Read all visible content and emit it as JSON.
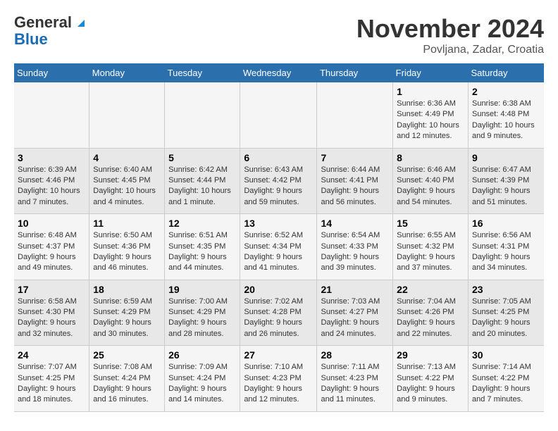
{
  "logo": {
    "line1": "General",
    "line2": "Blue"
  },
  "title": "November 2024",
  "subtitle": "Povljana, Zadar, Croatia",
  "header_color": "#2c6fad",
  "days_of_week": [
    "Sunday",
    "Monday",
    "Tuesday",
    "Wednesday",
    "Thursday",
    "Friday",
    "Saturday"
  ],
  "weeks": [
    [
      {
        "day": "",
        "info": ""
      },
      {
        "day": "",
        "info": ""
      },
      {
        "day": "",
        "info": ""
      },
      {
        "day": "",
        "info": ""
      },
      {
        "day": "",
        "info": ""
      },
      {
        "day": "1",
        "info": "Sunrise: 6:36 AM\nSunset: 4:49 PM\nDaylight: 10 hours and 12 minutes."
      },
      {
        "day": "2",
        "info": "Sunrise: 6:38 AM\nSunset: 4:48 PM\nDaylight: 10 hours and 9 minutes."
      }
    ],
    [
      {
        "day": "3",
        "info": "Sunrise: 6:39 AM\nSunset: 4:46 PM\nDaylight: 10 hours and 7 minutes."
      },
      {
        "day": "4",
        "info": "Sunrise: 6:40 AM\nSunset: 4:45 PM\nDaylight: 10 hours and 4 minutes."
      },
      {
        "day": "5",
        "info": "Sunrise: 6:42 AM\nSunset: 4:44 PM\nDaylight: 10 hours and 1 minute."
      },
      {
        "day": "6",
        "info": "Sunrise: 6:43 AM\nSunset: 4:42 PM\nDaylight: 9 hours and 59 minutes."
      },
      {
        "day": "7",
        "info": "Sunrise: 6:44 AM\nSunset: 4:41 PM\nDaylight: 9 hours and 56 minutes."
      },
      {
        "day": "8",
        "info": "Sunrise: 6:46 AM\nSunset: 4:40 PM\nDaylight: 9 hours and 54 minutes."
      },
      {
        "day": "9",
        "info": "Sunrise: 6:47 AM\nSunset: 4:39 PM\nDaylight: 9 hours and 51 minutes."
      }
    ],
    [
      {
        "day": "10",
        "info": "Sunrise: 6:48 AM\nSunset: 4:37 PM\nDaylight: 9 hours and 49 minutes."
      },
      {
        "day": "11",
        "info": "Sunrise: 6:50 AM\nSunset: 4:36 PM\nDaylight: 9 hours and 46 minutes."
      },
      {
        "day": "12",
        "info": "Sunrise: 6:51 AM\nSunset: 4:35 PM\nDaylight: 9 hours and 44 minutes."
      },
      {
        "day": "13",
        "info": "Sunrise: 6:52 AM\nSunset: 4:34 PM\nDaylight: 9 hours and 41 minutes."
      },
      {
        "day": "14",
        "info": "Sunrise: 6:54 AM\nSunset: 4:33 PM\nDaylight: 9 hours and 39 minutes."
      },
      {
        "day": "15",
        "info": "Sunrise: 6:55 AM\nSunset: 4:32 PM\nDaylight: 9 hours and 37 minutes."
      },
      {
        "day": "16",
        "info": "Sunrise: 6:56 AM\nSunset: 4:31 PM\nDaylight: 9 hours and 34 minutes."
      }
    ],
    [
      {
        "day": "17",
        "info": "Sunrise: 6:58 AM\nSunset: 4:30 PM\nDaylight: 9 hours and 32 minutes."
      },
      {
        "day": "18",
        "info": "Sunrise: 6:59 AM\nSunset: 4:29 PM\nDaylight: 9 hours and 30 minutes."
      },
      {
        "day": "19",
        "info": "Sunrise: 7:00 AM\nSunset: 4:29 PM\nDaylight: 9 hours and 28 minutes."
      },
      {
        "day": "20",
        "info": "Sunrise: 7:02 AM\nSunset: 4:28 PM\nDaylight: 9 hours and 26 minutes."
      },
      {
        "day": "21",
        "info": "Sunrise: 7:03 AM\nSunset: 4:27 PM\nDaylight: 9 hours and 24 minutes."
      },
      {
        "day": "22",
        "info": "Sunrise: 7:04 AM\nSunset: 4:26 PM\nDaylight: 9 hours and 22 minutes."
      },
      {
        "day": "23",
        "info": "Sunrise: 7:05 AM\nSunset: 4:25 PM\nDaylight: 9 hours and 20 minutes."
      }
    ],
    [
      {
        "day": "24",
        "info": "Sunrise: 7:07 AM\nSunset: 4:25 PM\nDaylight: 9 hours and 18 minutes."
      },
      {
        "day": "25",
        "info": "Sunrise: 7:08 AM\nSunset: 4:24 PM\nDaylight: 9 hours and 16 minutes."
      },
      {
        "day": "26",
        "info": "Sunrise: 7:09 AM\nSunset: 4:24 PM\nDaylight: 9 hours and 14 minutes."
      },
      {
        "day": "27",
        "info": "Sunrise: 7:10 AM\nSunset: 4:23 PM\nDaylight: 9 hours and 12 minutes."
      },
      {
        "day": "28",
        "info": "Sunrise: 7:11 AM\nSunset: 4:23 PM\nDaylight: 9 hours and 11 minutes."
      },
      {
        "day": "29",
        "info": "Sunrise: 7:13 AM\nSunset: 4:22 PM\nDaylight: 9 hours and 9 minutes."
      },
      {
        "day": "30",
        "info": "Sunrise: 7:14 AM\nSunset: 4:22 PM\nDaylight: 9 hours and 7 minutes."
      }
    ]
  ]
}
